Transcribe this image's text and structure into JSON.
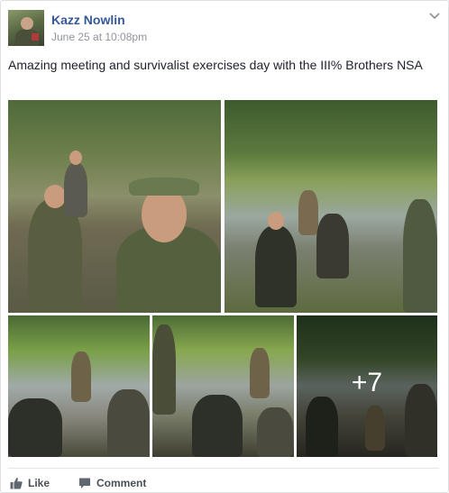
{
  "post": {
    "author": "Kazz Nowlin",
    "timestamp": "June 25 at 10:08pm",
    "text": "Amazing meeting and survivalist exercises day with the III% Brothers NSA",
    "more_photos_label": "+7"
  },
  "actions": {
    "like_label": "Like",
    "comment_label": "Comment"
  },
  "colors": {
    "link": "#365899",
    "meta": "#90949c",
    "text": "#1d2129",
    "action": "#4b4f56"
  },
  "icons": {
    "options": "chevron-down-icon",
    "like": "thumbs-up-icon",
    "comment": "speech-bubble-icon"
  }
}
